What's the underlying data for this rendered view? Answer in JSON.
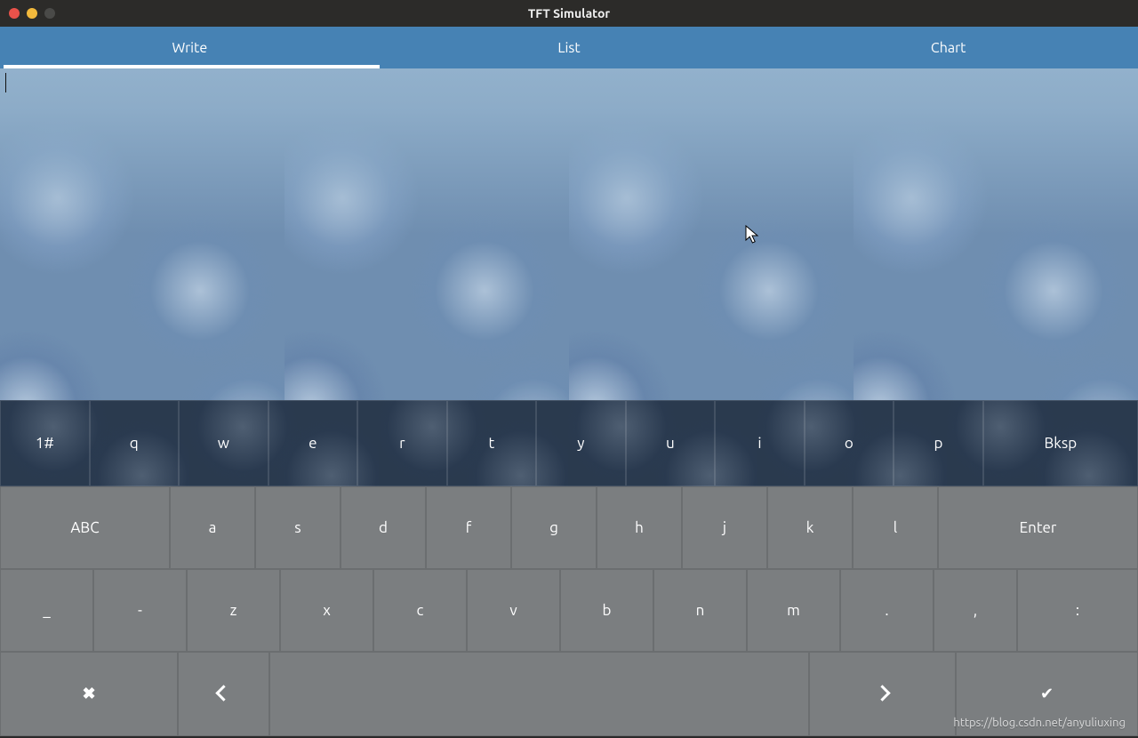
{
  "window": {
    "title": "TFT Simulator"
  },
  "tabs": {
    "write": "Write",
    "list": "List",
    "chart": "Chart",
    "active": "write"
  },
  "editor": {
    "value": ""
  },
  "keyboard": {
    "row1": {
      "numsym": "1#",
      "keys": [
        "q",
        "w",
        "e",
        "r",
        "t",
        "y",
        "u",
        "i",
        "o",
        "p"
      ],
      "bksp": "Bksp"
    },
    "row2": {
      "shift": "ABC",
      "keys": [
        "a",
        "s",
        "d",
        "f",
        "g",
        "h",
        "j",
        "k",
        "l"
      ],
      "enter": "Enter"
    },
    "row3": {
      "keys": [
        "_",
        "-",
        "z",
        "x",
        "c",
        "v",
        "b",
        "n",
        "m",
        ".",
        ",",
        ":"
      ]
    },
    "row4": {
      "close": "✖",
      "left": "‹",
      "space": "",
      "right": "›",
      "ok": "✔"
    }
  },
  "watermark": "https://blog.csdn.net/anyuliuxing"
}
